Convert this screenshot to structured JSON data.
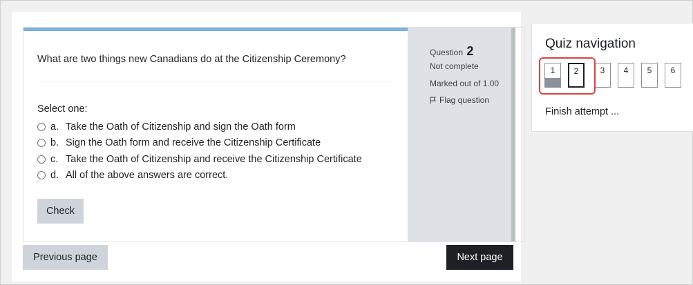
{
  "question": {
    "text": "What are two things new Canadians do at the Citizenship Ceremony?",
    "prompt": "Select one:",
    "answers": [
      {
        "letter": "a.",
        "text": "Take the Oath of Citizenship and sign the Oath form"
      },
      {
        "letter": "b.",
        "text": "Sign the Oath form and receive the Citizenship Certificate"
      },
      {
        "letter": "c.",
        "text": "Take the Oath of Citizenship and receive the Citizenship Certificate"
      },
      {
        "letter": "d.",
        "text": "All of the above answers are correct."
      }
    ],
    "check_label": "Check"
  },
  "info": {
    "question_label": "Question",
    "question_number": "2",
    "state": "Not complete",
    "grade": "Marked out of 1.00",
    "flag_label": "Flag question"
  },
  "footer": {
    "prev_label": "Previous page",
    "next_label": "Next page"
  },
  "nav": {
    "title": "Quiz navigation",
    "buttons": [
      "1",
      "2",
      "3",
      "4",
      "5",
      "6"
    ],
    "answered": [
      true,
      false,
      false,
      false,
      false,
      false
    ],
    "current": "2",
    "finish_label": "Finish attempt ..."
  },
  "colors": {
    "accent_bar": "#7bb3dc",
    "highlight": "#e0413d",
    "next_button": "#1d2125",
    "info_panel": "#dee2e6"
  }
}
